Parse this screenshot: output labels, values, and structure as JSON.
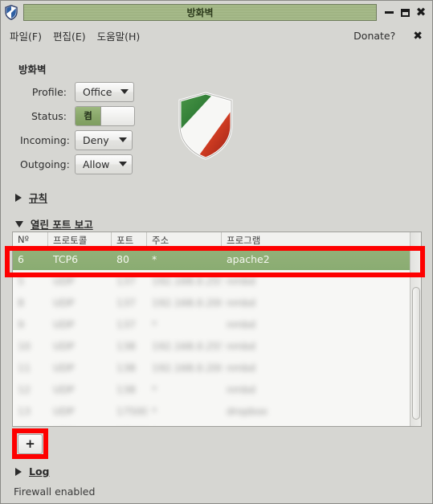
{
  "window": {
    "title": "방화벽",
    "icon": "shield-icon",
    "controls": {
      "minimize": "minimize-icon",
      "maximize": "maximize-icon",
      "close": "✖"
    }
  },
  "menubar": {
    "items": [
      {
        "label": "파일(F)"
      },
      {
        "label": "편집(E)"
      },
      {
        "label": "도움말(H)"
      }
    ],
    "donate_label": "Donate?",
    "close_label": "✖"
  },
  "firewall": {
    "section_title": "방화벽",
    "fields": [
      {
        "label": "Profile:",
        "type": "combo",
        "value": "Office"
      },
      {
        "label": "Status:",
        "type": "switch",
        "value": "켬"
      },
      {
        "label": "Incoming:",
        "type": "combo",
        "value": "Deny"
      },
      {
        "label": "Outgoing:",
        "type": "combo",
        "value": "Allow"
      }
    ],
    "logo": "gufw-shield-logo"
  },
  "expanders": {
    "rules": {
      "label": "규칙",
      "expanded": false
    },
    "ports": {
      "label": "열린 포트 보고",
      "expanded": true
    },
    "log": {
      "label": "Log",
      "expanded": false
    }
  },
  "ports_table": {
    "headers": [
      "Nº",
      "프로토콜",
      "포트",
      "주소",
      "프로그램"
    ],
    "selected_row": {
      "no": "6",
      "protocol": "TCP6",
      "port": "80",
      "address": "*",
      "program": "apache2"
    },
    "blurred_rows": [
      {
        "no": "",
        "protocol": "",
        "port": "",
        "address": "",
        "program": ""
      },
      {
        "no": "",
        "protocol": "",
        "port": "",
        "address": "",
        "program": ""
      },
      {
        "no": "",
        "protocol": "",
        "port": "",
        "address": "",
        "program": ""
      },
      {
        "no": "",
        "protocol": "",
        "port": "",
        "address": "",
        "program": ""
      },
      {
        "no": "",
        "protocol": "",
        "port": "",
        "address": "",
        "program": ""
      },
      {
        "no": "",
        "protocol": "",
        "port": "",
        "address": "",
        "program": ""
      },
      {
        "no": "",
        "protocol": "",
        "port": "",
        "address": "",
        "program": ""
      }
    ]
  },
  "toolbar": {
    "add_label": "+"
  },
  "statusbar": {
    "text": "Firewall enabled"
  },
  "colors": {
    "selection_green": "#8aac72",
    "annotation_red": "#fe0000",
    "window_bg": "#d6d6d2",
    "titlebar_green": "#a9bd8d"
  }
}
